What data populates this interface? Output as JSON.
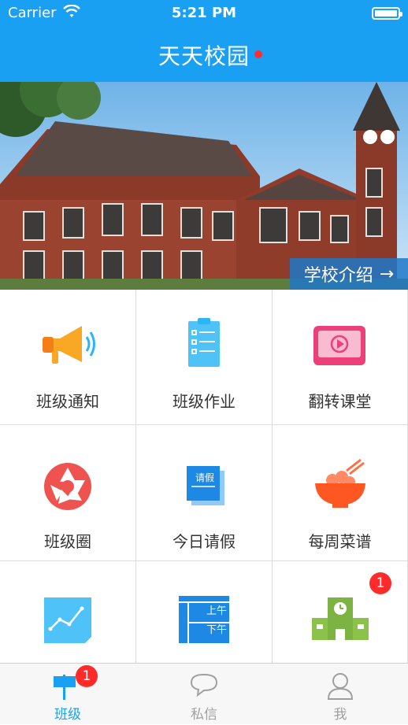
{
  "status_bar": {
    "carrier": "Carrier",
    "time": "5:21 PM"
  },
  "nav": {
    "title": "天天校园"
  },
  "banner": {
    "link_label": "学校介绍",
    "arrow": "→"
  },
  "grid": {
    "items": [
      {
        "label": "班级通知",
        "icon": "megaphone-icon"
      },
      {
        "label": "班级作业",
        "icon": "clipboard-icon"
      },
      {
        "label": "翻转课堂",
        "icon": "video-tv-icon"
      },
      {
        "label": "班级圈",
        "icon": "camera-aperture-icon"
      },
      {
        "label": "今日请假",
        "icon": "leave-note-icon",
        "icon_text": "请假"
      },
      {
        "label": "每周菜谱",
        "icon": "food-bowl-icon"
      },
      {
        "label": "",
        "icon": "chart-trend-icon"
      },
      {
        "label": "",
        "icon": "schedule-icon",
        "icon_text_top": "上午",
        "icon_text_bottom": "下午"
      },
      {
        "label": "",
        "icon": "school-building-icon",
        "badge": "1"
      }
    ]
  },
  "tabbar": {
    "tabs": [
      {
        "label": "班级",
        "icon": "class-flag-icon",
        "badge": "1",
        "active": true
      },
      {
        "label": "私信",
        "icon": "chat-bubble-icon"
      },
      {
        "label": "我",
        "icon": "person-icon"
      }
    ]
  },
  "colors": {
    "primary": "#1aa0f2",
    "badge": "#ff2b2b"
  }
}
